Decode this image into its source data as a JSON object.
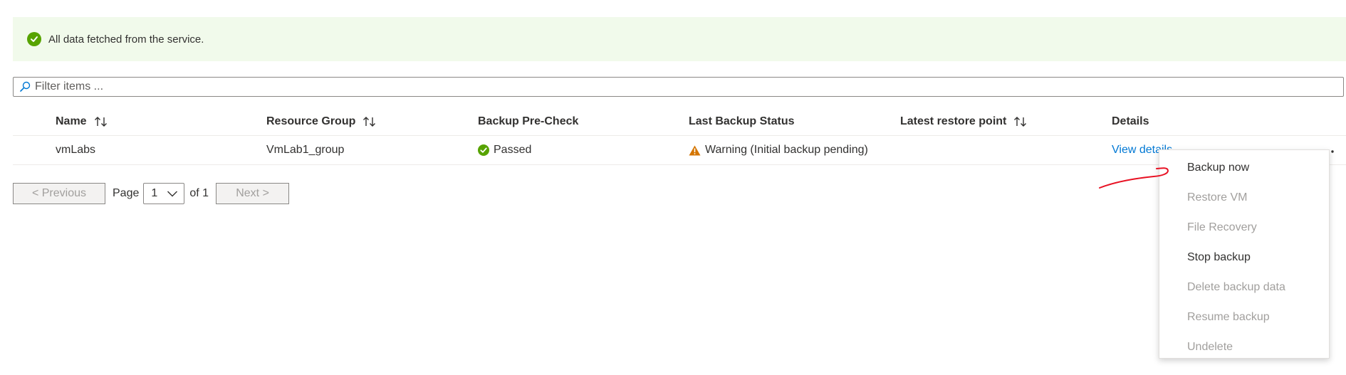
{
  "banner": {
    "text": "All data fetched from the service.",
    "icon": "check-circle-icon",
    "color": "#57a300"
  },
  "filter": {
    "placeholder": "Filter items ..."
  },
  "table": {
    "columns": [
      {
        "label": "Name",
        "sortable": true
      },
      {
        "label": "Resource Group",
        "sortable": true
      },
      {
        "label": "Backup Pre-Check",
        "sortable": false
      },
      {
        "label": "Last Backup Status",
        "sortable": false
      },
      {
        "label": "Latest restore point",
        "sortable": true
      },
      {
        "label": "Details",
        "sortable": false
      }
    ],
    "rows": [
      {
        "name": "vmLabs",
        "resource_group": "VmLab1_group",
        "precheck": "Passed",
        "last_status": "Warning (Initial backup pending)",
        "restore_point": "",
        "details_link": "View details"
      }
    ]
  },
  "pager": {
    "previous": "< Previous",
    "page_label": "Page",
    "page_value": "1",
    "of_label": "of 1",
    "next": "Next >"
  },
  "context_menu": {
    "items": [
      {
        "label": "Backup now",
        "enabled": true
      },
      {
        "label": "Restore VM",
        "enabled": false
      },
      {
        "label": "File Recovery",
        "enabled": false
      },
      {
        "label": "Stop backup",
        "enabled": true
      },
      {
        "label": "Delete backup data",
        "enabled": false
      },
      {
        "label": "Resume backup",
        "enabled": false
      },
      {
        "label": "Undelete",
        "enabled": false
      }
    ]
  },
  "colors": {
    "accent": "#0078d4",
    "success": "#57a300",
    "warning": "#d47500",
    "annotation": "#e81123"
  }
}
